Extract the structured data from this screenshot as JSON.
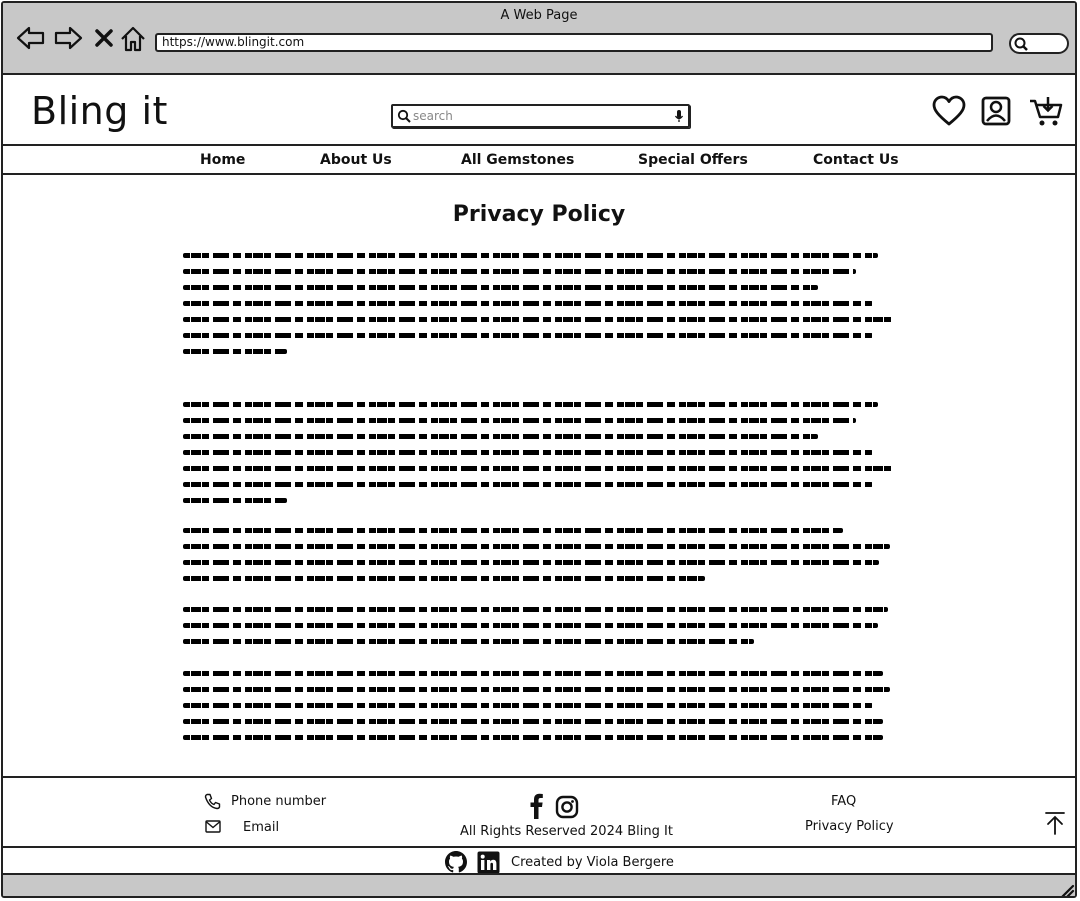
{
  "window": {
    "title": "A Web Page",
    "url": "https://www.blingit.com"
  },
  "header": {
    "logo": "Bling it",
    "search_placeholder": "search"
  },
  "nav": {
    "items": [
      "Home",
      "About Us",
      "All Gemstones",
      "Special Offers",
      "Contact Us"
    ]
  },
  "main": {
    "title": "Privacy Policy"
  },
  "footer": {
    "phone": "Phone number",
    "email": "Email",
    "copyright": "All Rights Reserved 2024 Bling It",
    "faq": "FAQ",
    "privacy": "Privacy Policy",
    "credit": "Created by Viola Bergere"
  },
  "icons": [
    "back-icon",
    "forward-icon",
    "close-icon",
    "home-icon",
    "search-icon",
    "mic-icon",
    "heart-icon",
    "account-icon",
    "cart-icon",
    "phone-icon",
    "mail-icon",
    "facebook-icon",
    "instagram-icon",
    "github-icon",
    "linkedin-icon",
    "back-to-top-icon",
    "resize-grip-icon"
  ]
}
